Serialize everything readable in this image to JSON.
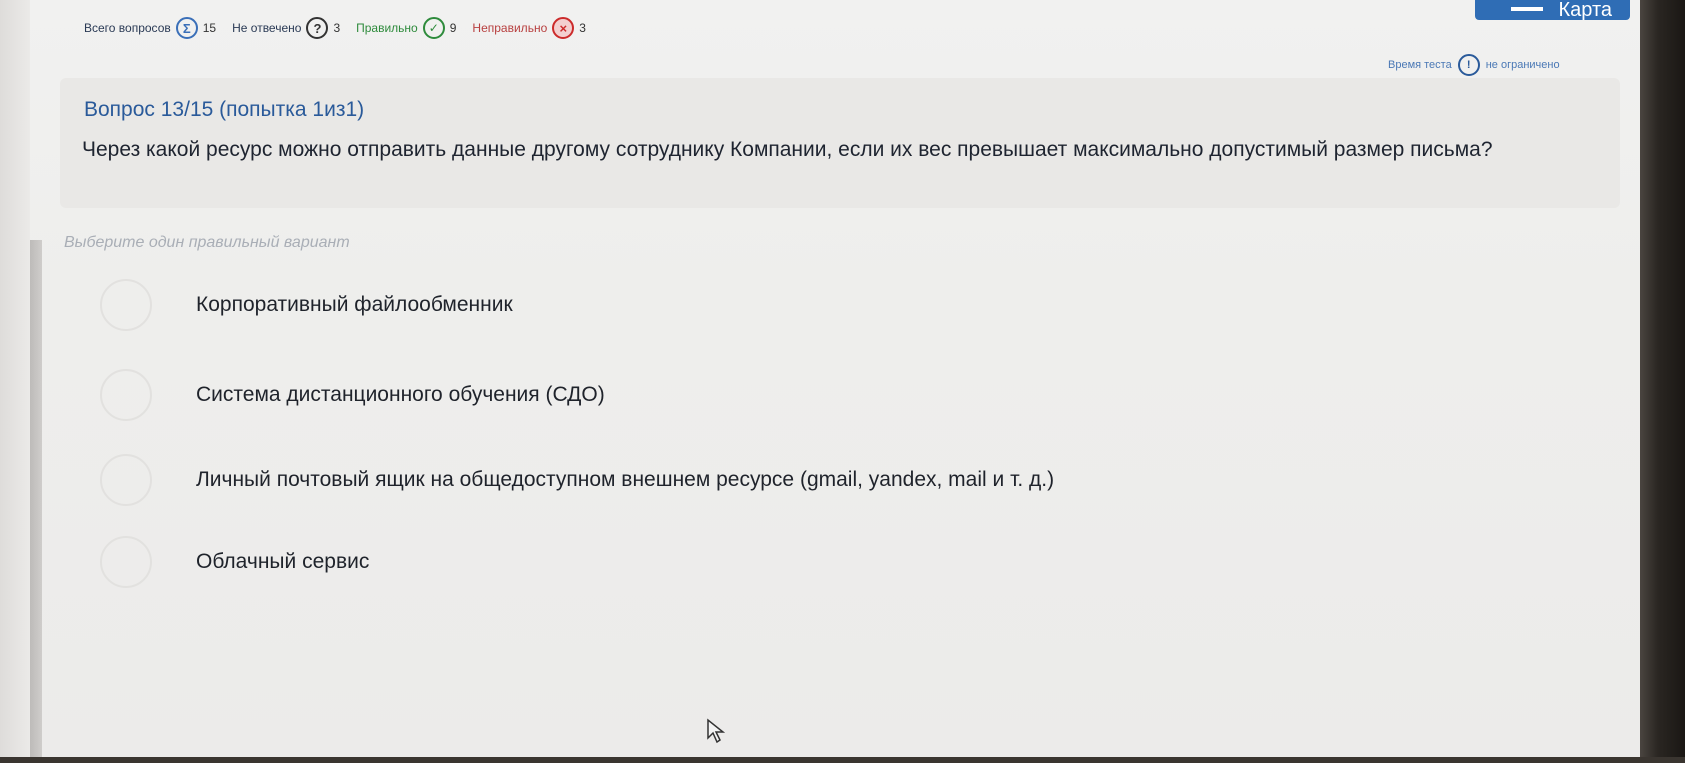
{
  "stats": {
    "total_label": "Всего вопросов",
    "total_icon": "sigma-icon",
    "total_value": "15",
    "unanswered_label": "Не отвечено",
    "unanswered_icon": "question-icon",
    "unanswered_value": "3",
    "correct_label": "Правильно",
    "correct_icon": "check-icon",
    "correct_value": "9",
    "wrong_label": "Неправильно",
    "wrong_icon": "cross-icon",
    "wrong_value": "3"
  },
  "map_button": {
    "label": "Карта"
  },
  "timer": {
    "label": "Время теста",
    "icon": "stopwatch-icon",
    "value": "не ограничено"
  },
  "question": {
    "number_label": "Вопрос 13/15  (попытка 1из1)",
    "text": "Через какой ресурс можно отправить данные другому сотруднику Компании, если их вес превышает максимально допустимый размер письма?"
  },
  "hint": "Выберите один правильный вариант",
  "options": [
    {
      "label": "Корпоративный файлообменник"
    },
    {
      "label": "Система дистанционного обучения (СДО)"
    },
    {
      "label": "Личный почтовый ящик на общедоступном внешнем ресурсе (gmail, yandex, mail и т. д.)"
    },
    {
      "label": "Облачный сервис"
    }
  ],
  "colors": {
    "accent": "#2f6db5",
    "correct": "#2e8b3c",
    "wrong": "#cc2b2b"
  }
}
